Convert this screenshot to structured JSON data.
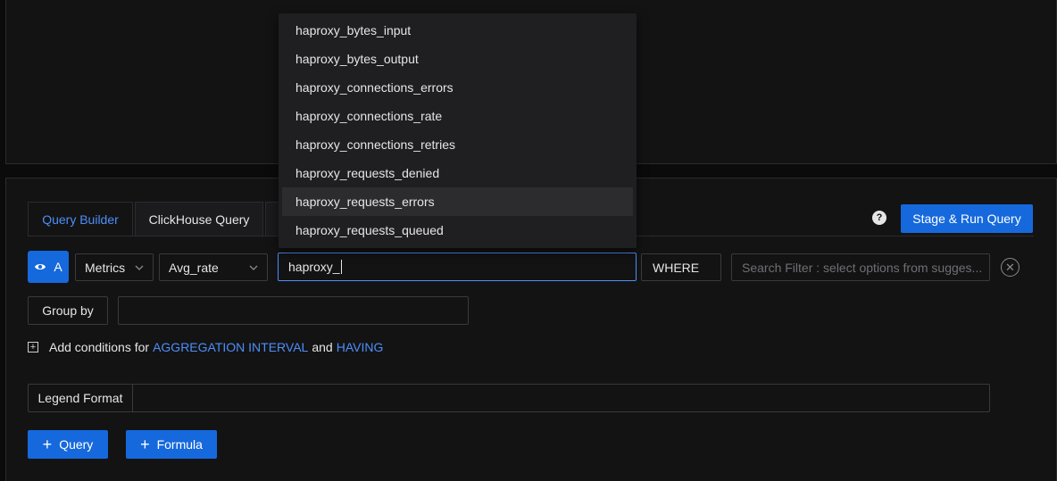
{
  "tabs": [
    "Query Builder",
    "ClickHouse Query"
  ],
  "help_glyph": "?",
  "stage_run_label": "Stage & Run Query",
  "query": {
    "letter": "A",
    "data_source": "Metrics",
    "aggregate": "Avg_rate",
    "metric_input": "haproxy_",
    "where_label": "WHERE",
    "search_filter_placeholder": "Search Filter : select options from sugges..."
  },
  "group_by": {
    "label": "Group by",
    "value": ""
  },
  "conditions": {
    "prefix": "Add conditions for",
    "link1": "AGGREGATION INTERVAL",
    "and": "and",
    "link2": "HAVING"
  },
  "legend": {
    "label": "Legend Format",
    "value": ""
  },
  "buttons": {
    "add_query": "Query",
    "add_formula": "Formula"
  },
  "suggestions": [
    "haproxy_bytes_input",
    "haproxy_bytes_output",
    "haproxy_connections_errors",
    "haproxy_connections_rate",
    "haproxy_connections_retries",
    "haproxy_requests_denied",
    "haproxy_requests_errors",
    "haproxy_requests_queued"
  ],
  "colors": {
    "accent": "#1669dc",
    "link": "#4e8ef7",
    "background": "#131314"
  }
}
